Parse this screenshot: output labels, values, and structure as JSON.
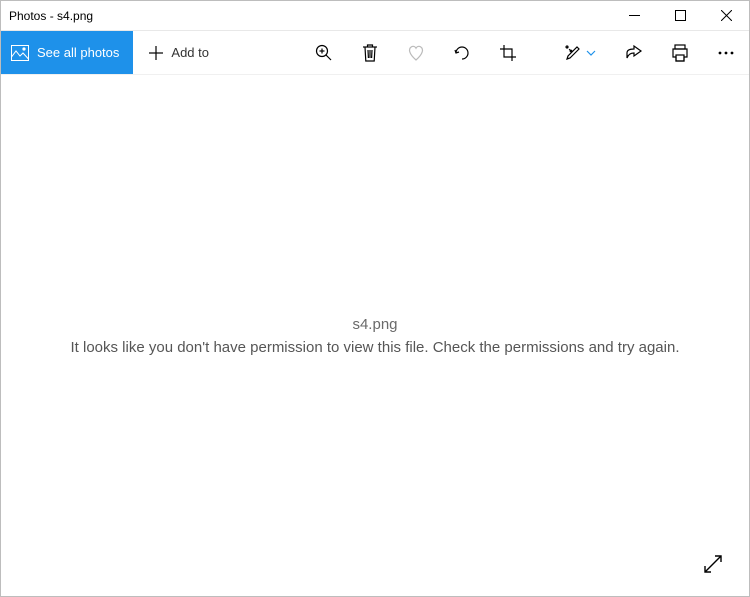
{
  "window": {
    "title": "Photos - s4.png"
  },
  "toolbar": {
    "see_all_label": "See all photos",
    "add_to_label": "Add to"
  },
  "error": {
    "filename": "s4.png",
    "message": "It looks like you don't have permission to view this file. Check the permissions and try again."
  }
}
